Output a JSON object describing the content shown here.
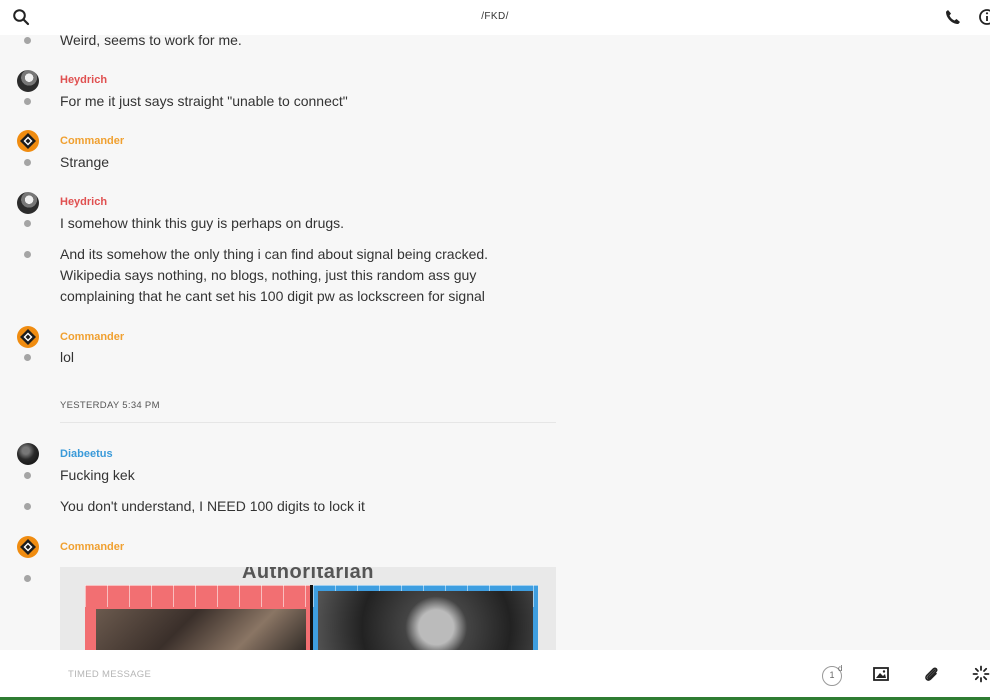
{
  "header": {
    "title": "/FKD/",
    "icons": [
      "search-icon",
      "phone-icon",
      "info-icon"
    ]
  },
  "messages": [
    {
      "text": "Weird, seems to work for me."
    },
    {
      "sender": "Heydrich",
      "sender_color": "#e05050",
      "avatar": "heydrich-avatar",
      "text": "For me it just says straight \"unable to connect\""
    },
    {
      "sender": "Commander",
      "sender_color": "#f0a030",
      "avatar": "commander-avatar",
      "text": "Strange"
    },
    {
      "sender": "Heydrich",
      "sender_color": "#e05050",
      "avatar": "heydrich-avatar",
      "text": "I somehow think this guy is perhaps on drugs."
    },
    {
      "lines": [
        "And its somehow the only thing i can find about signal being cracked.",
        "Wikipedia says nothing, no blogs, nothing, just this random ass guy",
        "complaining that he cant set his 100 digit pw as lockscreen for signal"
      ]
    },
    {
      "sender": "Commander",
      "sender_color": "#f0a030",
      "avatar": "commander-avatar",
      "text": "lol"
    },
    {
      "sender": "Diabeetus",
      "sender_color": "#3a9ad9",
      "avatar": "diabeetus-avatar",
      "text": "Fucking kek"
    },
    {
      "text": "You don't understand, I NEED 100 digits to lock it"
    },
    {
      "sender": "Commander",
      "sender_color": "#f0a030",
      "avatar": "commander-avatar",
      "attachment_title": "Authoritarian"
    }
  ],
  "divider": {
    "label": "YESTERDAY 5:34 PM"
  },
  "composer": {
    "placeholder": "TIMED MESSAGE",
    "timer_value": "1",
    "timer_unit": "d",
    "icons": [
      "timer-icon",
      "image-icon",
      "paperclip-icon",
      "sparkle-icon"
    ]
  },
  "colors": {
    "accent_orange": "#f08c10",
    "name_red": "#e05050",
    "name_blue": "#3a9ad9",
    "status_bar": "#2e7d32"
  }
}
